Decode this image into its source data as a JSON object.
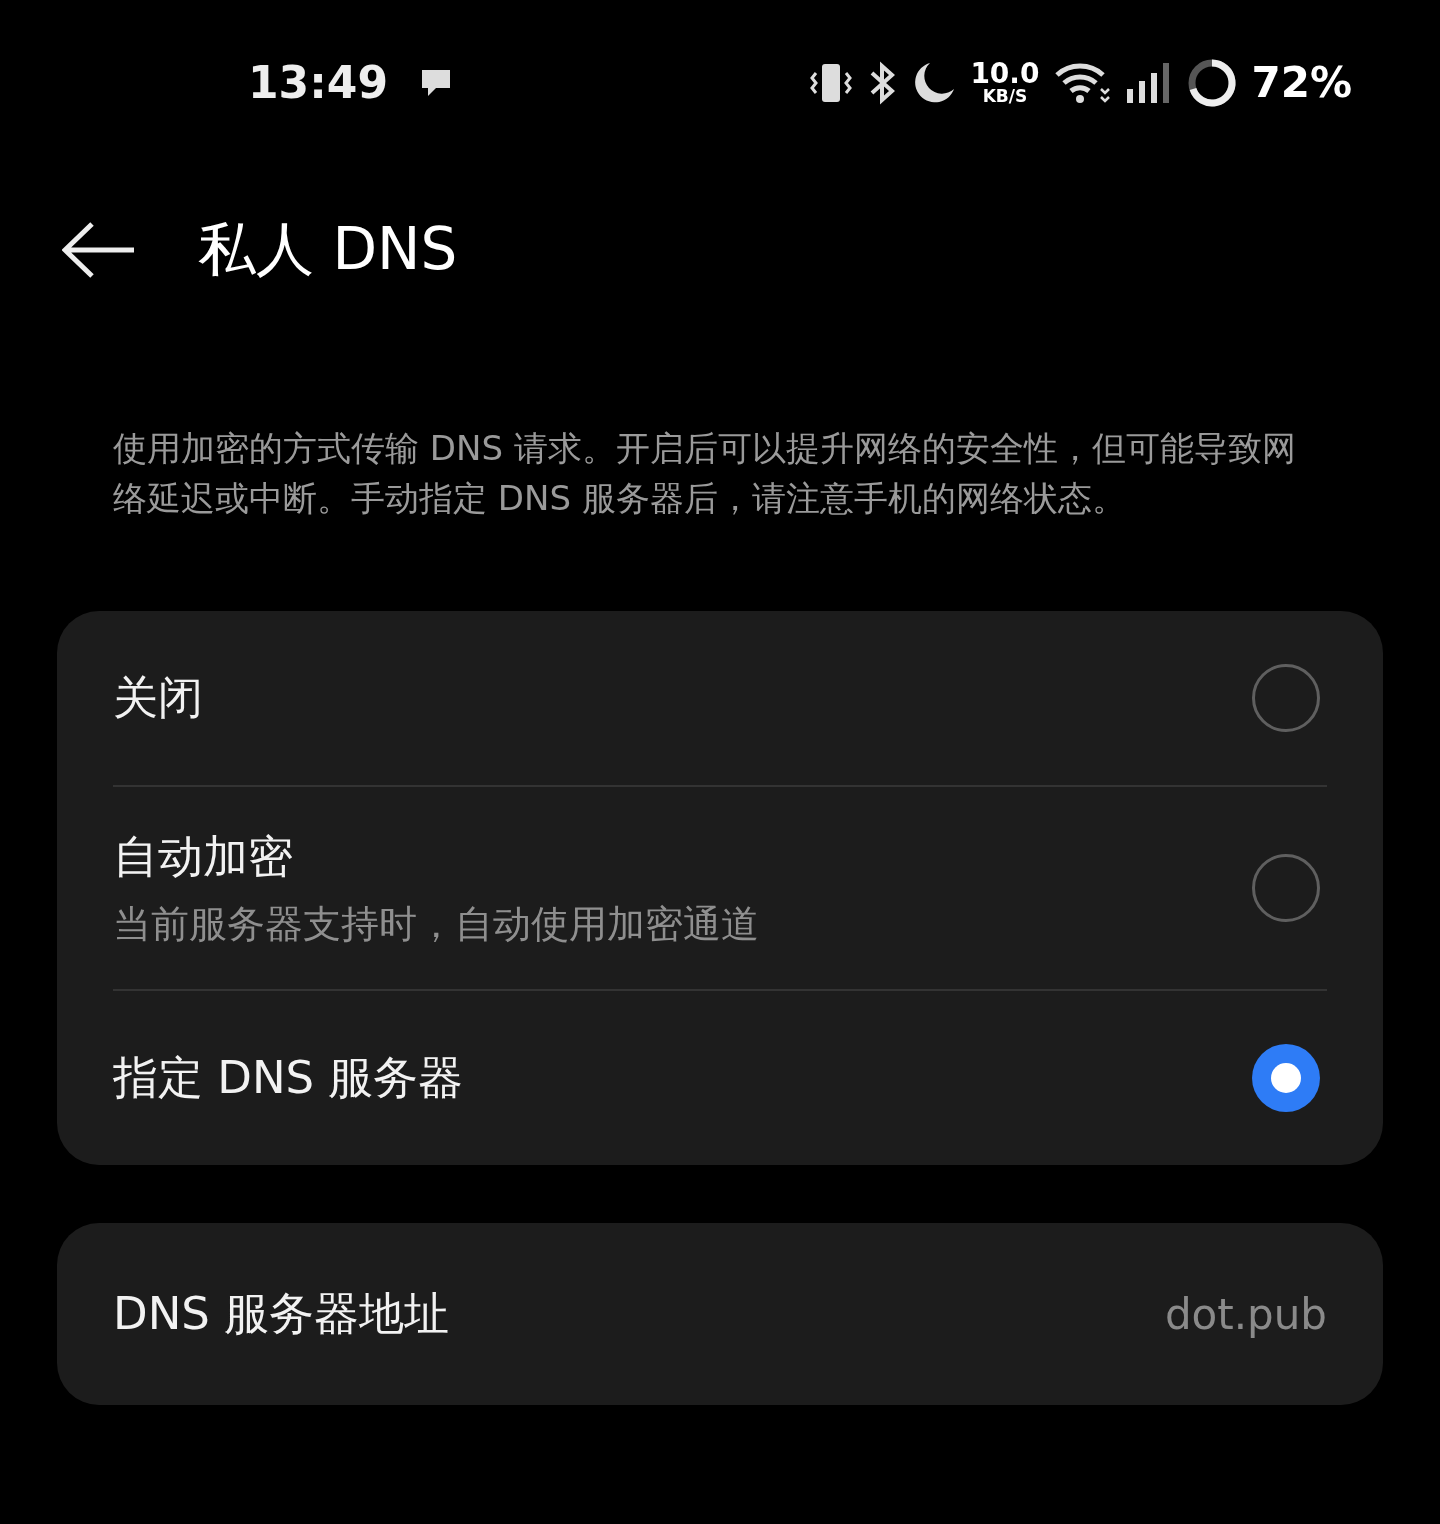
{
  "status_bar": {
    "time": "13:49",
    "net_speed": "10.0",
    "net_unit": "KB/S",
    "battery": "72%"
  },
  "header": {
    "title": "私人 DNS"
  },
  "description": "使用加密的方式传输 DNS 请求。开启后可以提升网络的安全性，但可能导致网络延迟或中断。手动指定 DNS 服务器后，请注意手机的网络状态。",
  "options": [
    {
      "label": "关闭",
      "selected": false
    },
    {
      "label": "自动加密",
      "subtitle": "当前服务器支持时，自动使用加密通道",
      "selected": false
    },
    {
      "label": "指定 DNS 服务器",
      "selected": true
    }
  ],
  "server": {
    "label": "DNS 服务器地址",
    "value": "dot.pub"
  }
}
